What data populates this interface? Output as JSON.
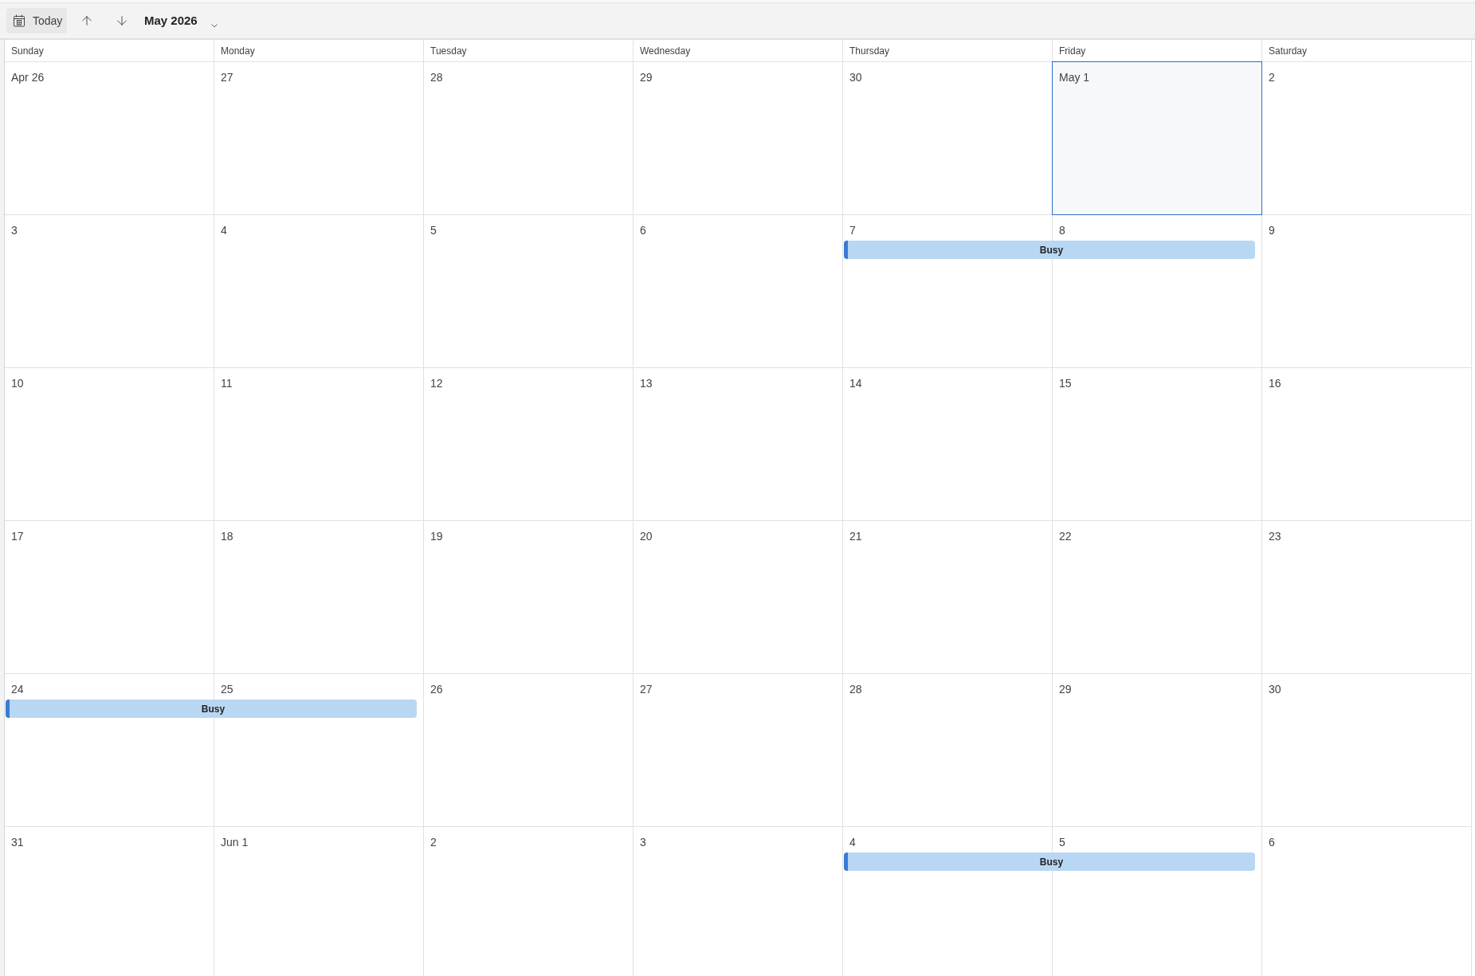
{
  "toolbar": {
    "today_button": "Today",
    "month_title": "May 2026"
  },
  "weekdays": [
    "Sunday",
    "Monday",
    "Tuesday",
    "Wednesday",
    "Thursday",
    "Friday",
    "Saturday"
  ],
  "weeks": [
    {
      "days": [
        {
          "label": "Apr 26",
          "selected": false
        },
        {
          "label": "27",
          "selected": false
        },
        {
          "label": "28",
          "selected": false
        },
        {
          "label": "29",
          "selected": false
        },
        {
          "label": "30",
          "selected": false
        },
        {
          "label": "May 1",
          "selected": true
        },
        {
          "label": "2",
          "selected": false
        }
      ]
    },
    {
      "days": [
        {
          "label": "3",
          "selected": false
        },
        {
          "label": "4",
          "selected": false
        },
        {
          "label": "5",
          "selected": false
        },
        {
          "label": "6",
          "selected": false
        },
        {
          "label": "7",
          "selected": false,
          "event": {
            "title": "Busy"
          }
        },
        {
          "label": "8",
          "selected": false,
          "event_continued": true
        },
        {
          "label": "9",
          "selected": false
        }
      ]
    },
    {
      "days": [
        {
          "label": "10",
          "selected": false
        },
        {
          "label": "11",
          "selected": false
        },
        {
          "label": "12",
          "selected": false
        },
        {
          "label": "13",
          "selected": false
        },
        {
          "label": "14",
          "selected": false
        },
        {
          "label": "15",
          "selected": false
        },
        {
          "label": "16",
          "selected": false
        }
      ]
    },
    {
      "days": [
        {
          "label": "17",
          "selected": false
        },
        {
          "label": "18",
          "selected": false
        },
        {
          "label": "19",
          "selected": false
        },
        {
          "label": "20",
          "selected": false
        },
        {
          "label": "21",
          "selected": false
        },
        {
          "label": "22",
          "selected": false
        },
        {
          "label": "23",
          "selected": false
        }
      ]
    },
    {
      "days": [
        {
          "label": "24",
          "selected": false,
          "event": {
            "title": "Busy"
          }
        },
        {
          "label": "25",
          "selected": false,
          "event_continued": true
        },
        {
          "label": "26",
          "selected": false
        },
        {
          "label": "27",
          "selected": false
        },
        {
          "label": "28",
          "selected": false
        },
        {
          "label": "29",
          "selected": false
        },
        {
          "label": "30",
          "selected": false
        }
      ]
    },
    {
      "days": [
        {
          "label": "31",
          "selected": false
        },
        {
          "label": "Jun 1",
          "selected": false
        },
        {
          "label": "2",
          "selected": false
        },
        {
          "label": "3",
          "selected": false
        },
        {
          "label": "4",
          "selected": false,
          "event": {
            "title": "Busy"
          }
        },
        {
          "label": "5",
          "selected": false,
          "event_continued": true
        },
        {
          "label": "6",
          "selected": false
        }
      ]
    }
  ]
}
